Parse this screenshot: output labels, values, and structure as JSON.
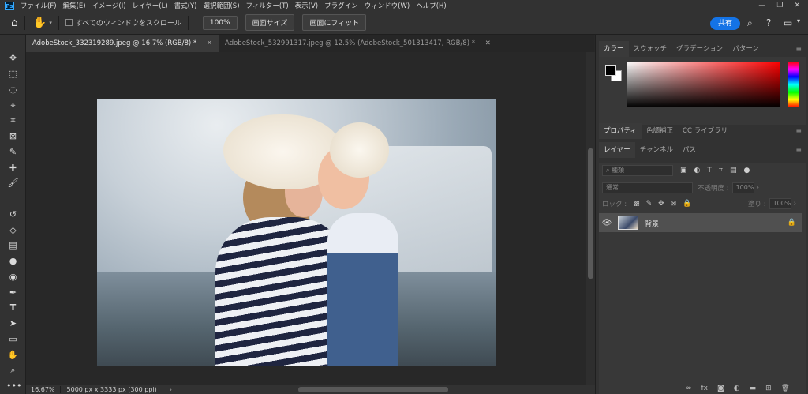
{
  "menubar": {
    "items": [
      "ファイル(F)",
      "編集(E)",
      "イメージ(I)",
      "レイヤー(L)",
      "書式(Y)",
      "選択範囲(S)",
      "フィルター(T)",
      "表示(V)",
      "プラグイン",
      "ウィンドウ(W)",
      "ヘルプ(H)"
    ]
  },
  "options": {
    "scroll_all_label": "すべてのウィンドウをスクロール",
    "zoom_btn": "100%",
    "fit_screen_btn": "画面サイズ",
    "fill_screen_btn": "画面にフィット",
    "share_label": "共有"
  },
  "tabs": [
    {
      "label": "AdobeStock_332319289.jpeg @ 16.7% (RGB/8) *",
      "active": true
    },
    {
      "label": "AdobeStock_532991317.jpeg @ 12.5% (AdobeStock_501313417, RGB/8) *",
      "active": false
    }
  ],
  "status": {
    "zoom": "16.67%",
    "info": "5000 px x 3333 px (300 ppi)"
  },
  "color_panel": {
    "tabs": [
      "カラー",
      "スウォッチ",
      "グラデーション",
      "パターン"
    ],
    "foreground": "#000000",
    "background": "#ffffff"
  },
  "properties_panel": {
    "tabs": [
      "プロパティ",
      "色調補正",
      "CC ライブラリ"
    ]
  },
  "layers_panel": {
    "tabs": [
      "レイヤー",
      "チャンネル",
      "パス"
    ],
    "filter_placeholder": "種類",
    "blend_mode": "通常",
    "opacity_label": "不透明度 :",
    "opacity_value": "100%",
    "lock_label": "ロック :",
    "fill_label": "塗り :",
    "fill_value": "100%",
    "layers": [
      {
        "name": "背景",
        "visible": true,
        "locked": true
      }
    ]
  }
}
